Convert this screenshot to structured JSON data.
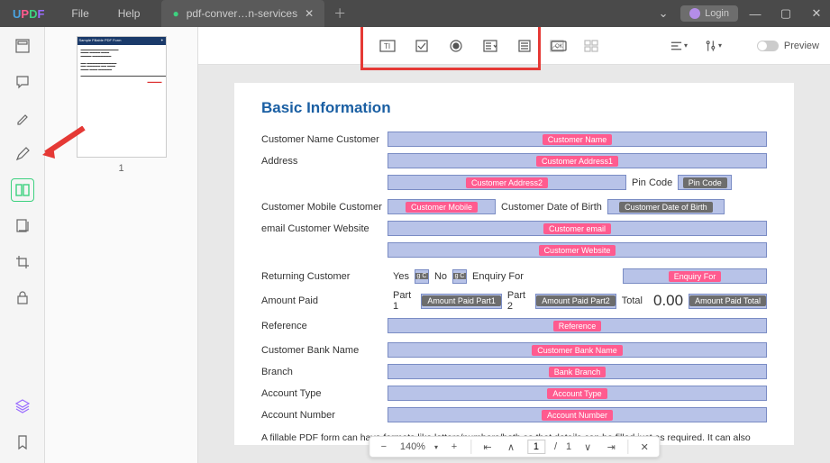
{
  "titlebar": {
    "menus": [
      "File",
      "Help"
    ],
    "tab_label": "pdf-conver…n-services",
    "login_label": "Login"
  },
  "thumb": {
    "title": "Sample Fillable PDF Form",
    "page_num": "1"
  },
  "preview_label": "Preview",
  "form": {
    "heading": "Basic Information",
    "labels": {
      "name": "Customer Name Customer",
      "address": "Address",
      "mobile": "Customer Mobile  Customer",
      "email_site": "email Customer Website",
      "returning": "Returning Customer",
      "amount": "Amount Paid",
      "reference": "Reference",
      "bank": "Customer Bank Name",
      "branch": "Branch",
      "acct_type": "Account Type",
      "acct_num": "Account Number",
      "pin": "Pin Code",
      "dob": "Customer Date of Birth",
      "yes": "Yes",
      "no": "No",
      "enquiry": "Enquiry For",
      "part1": "Part 1",
      "part2": "Part 2",
      "total": "Total"
    },
    "tags": {
      "name": "Customer Name",
      "addr1": "Customer Address1",
      "addr2": "Customer Address2",
      "pin": "Pin Code",
      "mobile": "Customer Mobile",
      "dob": "Customer Date of Birth",
      "email": "Customer email",
      "website": "Customer Website",
      "ret1": "g C",
      "ret2": "g C",
      "enquiry": "Enquiry For",
      "amt1": "Amount Paid Part1",
      "amt2": "Amount Paid Part2",
      "amt_total": "Amount Paid Total",
      "reference": "Reference",
      "bank": "Customer Bank Name",
      "branch": "Bank Branch",
      "acct_type": "Account Type",
      "acct_num": "Account Number"
    },
    "amount_value": "0.00",
    "body_text": "A fillable PDF form can have                                                                                                                                formats like letters/numbers/both so that details can be filled just as required. It can also have optional fields in a way that one or more choices as commanded can only be selected. The output data from a fillable PDF can be self-explanatory"
  },
  "bottombar": {
    "zoom": "140%",
    "page_cur": "1",
    "page_total": "1"
  }
}
